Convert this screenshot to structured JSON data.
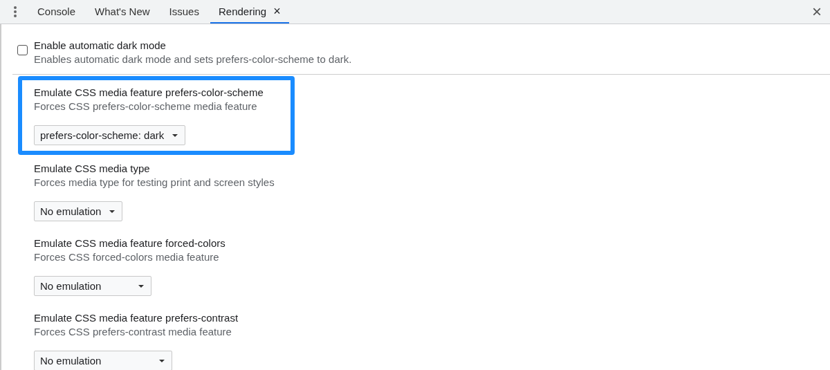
{
  "tabs": [
    {
      "label": "Console",
      "selected": false,
      "closable": false
    },
    {
      "label": "What's New",
      "selected": false,
      "closable": false
    },
    {
      "label": "Issues",
      "selected": false,
      "closable": false
    },
    {
      "label": "Rendering",
      "selected": true,
      "closable": true
    }
  ],
  "close_label": "×",
  "tab_close_label": "×",
  "checkbox_setting": {
    "label": "Enable automatic dark mode",
    "description": "Enables automatic dark mode and sets prefers-color-scheme to dark.",
    "checked": false
  },
  "settings": [
    {
      "title": "Emulate CSS media feature prefers-color-scheme",
      "description": "Forces CSS prefers-color-scheme media feature",
      "value": "prefers-color-scheme: dark",
      "highlighted": true
    },
    {
      "title": "Emulate CSS media type",
      "description": "Forces media type for testing print and screen styles",
      "value": "No emulation",
      "highlighted": false
    },
    {
      "title": "Emulate CSS media feature forced-colors",
      "description": "Forces CSS forced-colors media feature",
      "value": "No emulation",
      "highlighted": false
    },
    {
      "title": "Emulate CSS media feature prefers-contrast",
      "description": "Forces CSS prefers-contrast media feature",
      "value": "No emulation",
      "highlighted": false
    }
  ]
}
